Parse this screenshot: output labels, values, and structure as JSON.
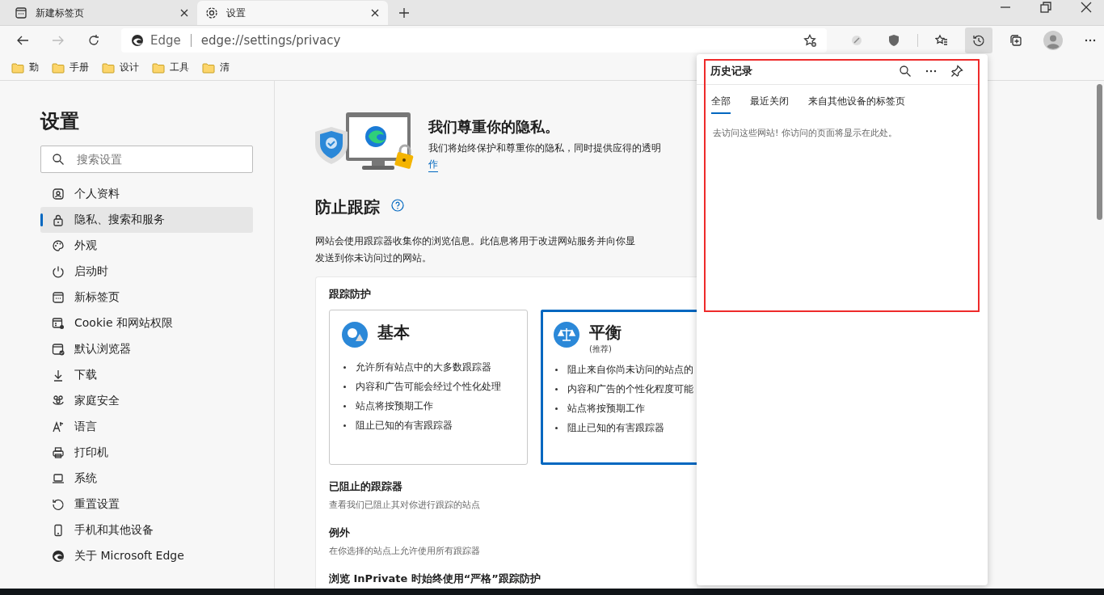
{
  "tabs": [
    {
      "title": "新建标签页",
      "selected": false,
      "kind": "newtab"
    },
    {
      "title": "设置",
      "selected": true,
      "kind": "settings"
    }
  ],
  "address_bar": {
    "site_label": "Edge",
    "url": "edge://settings/privacy"
  },
  "toolbar": {
    "history_open": true
  },
  "bookmarks": [
    "勤",
    "手册",
    "设计",
    "工具",
    "清"
  ],
  "sidebar": {
    "title": "设置",
    "search": {
      "placeholder": "搜索设置"
    },
    "items": [
      {
        "label": "个人资料",
        "selected": false
      },
      {
        "label": "隐私、搜索和服务",
        "selected": true
      },
      {
        "label": "外观",
        "selected": false
      },
      {
        "label": "启动时",
        "selected": false
      },
      {
        "label": "新标签页",
        "selected": false
      },
      {
        "label": "Cookie 和网站权限",
        "selected": false
      },
      {
        "label": "默认浏览器",
        "selected": false
      },
      {
        "label": "下载",
        "selected": false
      },
      {
        "label": "家庭安全",
        "selected": false
      },
      {
        "label": "语言",
        "selected": false
      },
      {
        "label": "打印机",
        "selected": false
      },
      {
        "label": "系统",
        "selected": false
      },
      {
        "label": "重置设置",
        "selected": false
      },
      {
        "label": "手机和其他设备",
        "selected": false
      },
      {
        "label": "关于 Microsoft Edge",
        "selected": false
      }
    ]
  },
  "hero": {
    "title": "我们尊重你的隐私。",
    "text": "我们将始终保护和尊重你的隐私，同时提供应得的透明",
    "link": "作"
  },
  "tracking": {
    "title": "防止跟踪",
    "description": [
      "网站会使用跟踪器收集你的浏览信息。此信息将用于改进网站服务并向你显",
      "发送到你未访问过的网站。"
    ],
    "panel_title": "跟踪防护",
    "levels": [
      {
        "kind": "basic",
        "name": "基本",
        "selected": false,
        "bullets": [
          "允许所有站点中的大多数跟踪器",
          "内容和广告可能会经过个性化处理",
          "站点将按预期工作",
          "阻止已知的有害跟踪器"
        ]
      },
      {
        "kind": "balanced",
        "name": "平衡",
        "note": "(推荐)",
        "selected": true,
        "bullets": [
          "阻止来自你尚未访问的站点的",
          "内容和广告的个性化程度可能",
          "站点将按预期工作",
          "阻止已知的有害跟踪器"
        ]
      }
    ],
    "sections": [
      {
        "title": "已阻止的跟踪器",
        "subtitle": "查看我们已阻止其对你进行跟踪的站点"
      },
      {
        "title": "例外",
        "subtitle": "在你选择的站点上允许使用所有跟踪器"
      },
      {
        "title": "浏览 InPrivate 时始终使用“严格”跟踪防护"
      }
    ]
  },
  "history_panel": {
    "title": "历史记录",
    "tabs": [
      {
        "label": "全部",
        "selected": true
      },
      {
        "label": "最近关闭",
        "selected": false
      },
      {
        "label": "来自其他设备的标签页",
        "selected": false
      }
    ],
    "empty_message": "去访问这些网站! 你访问的页面将显示在此处。",
    "highlighted": true
  }
}
